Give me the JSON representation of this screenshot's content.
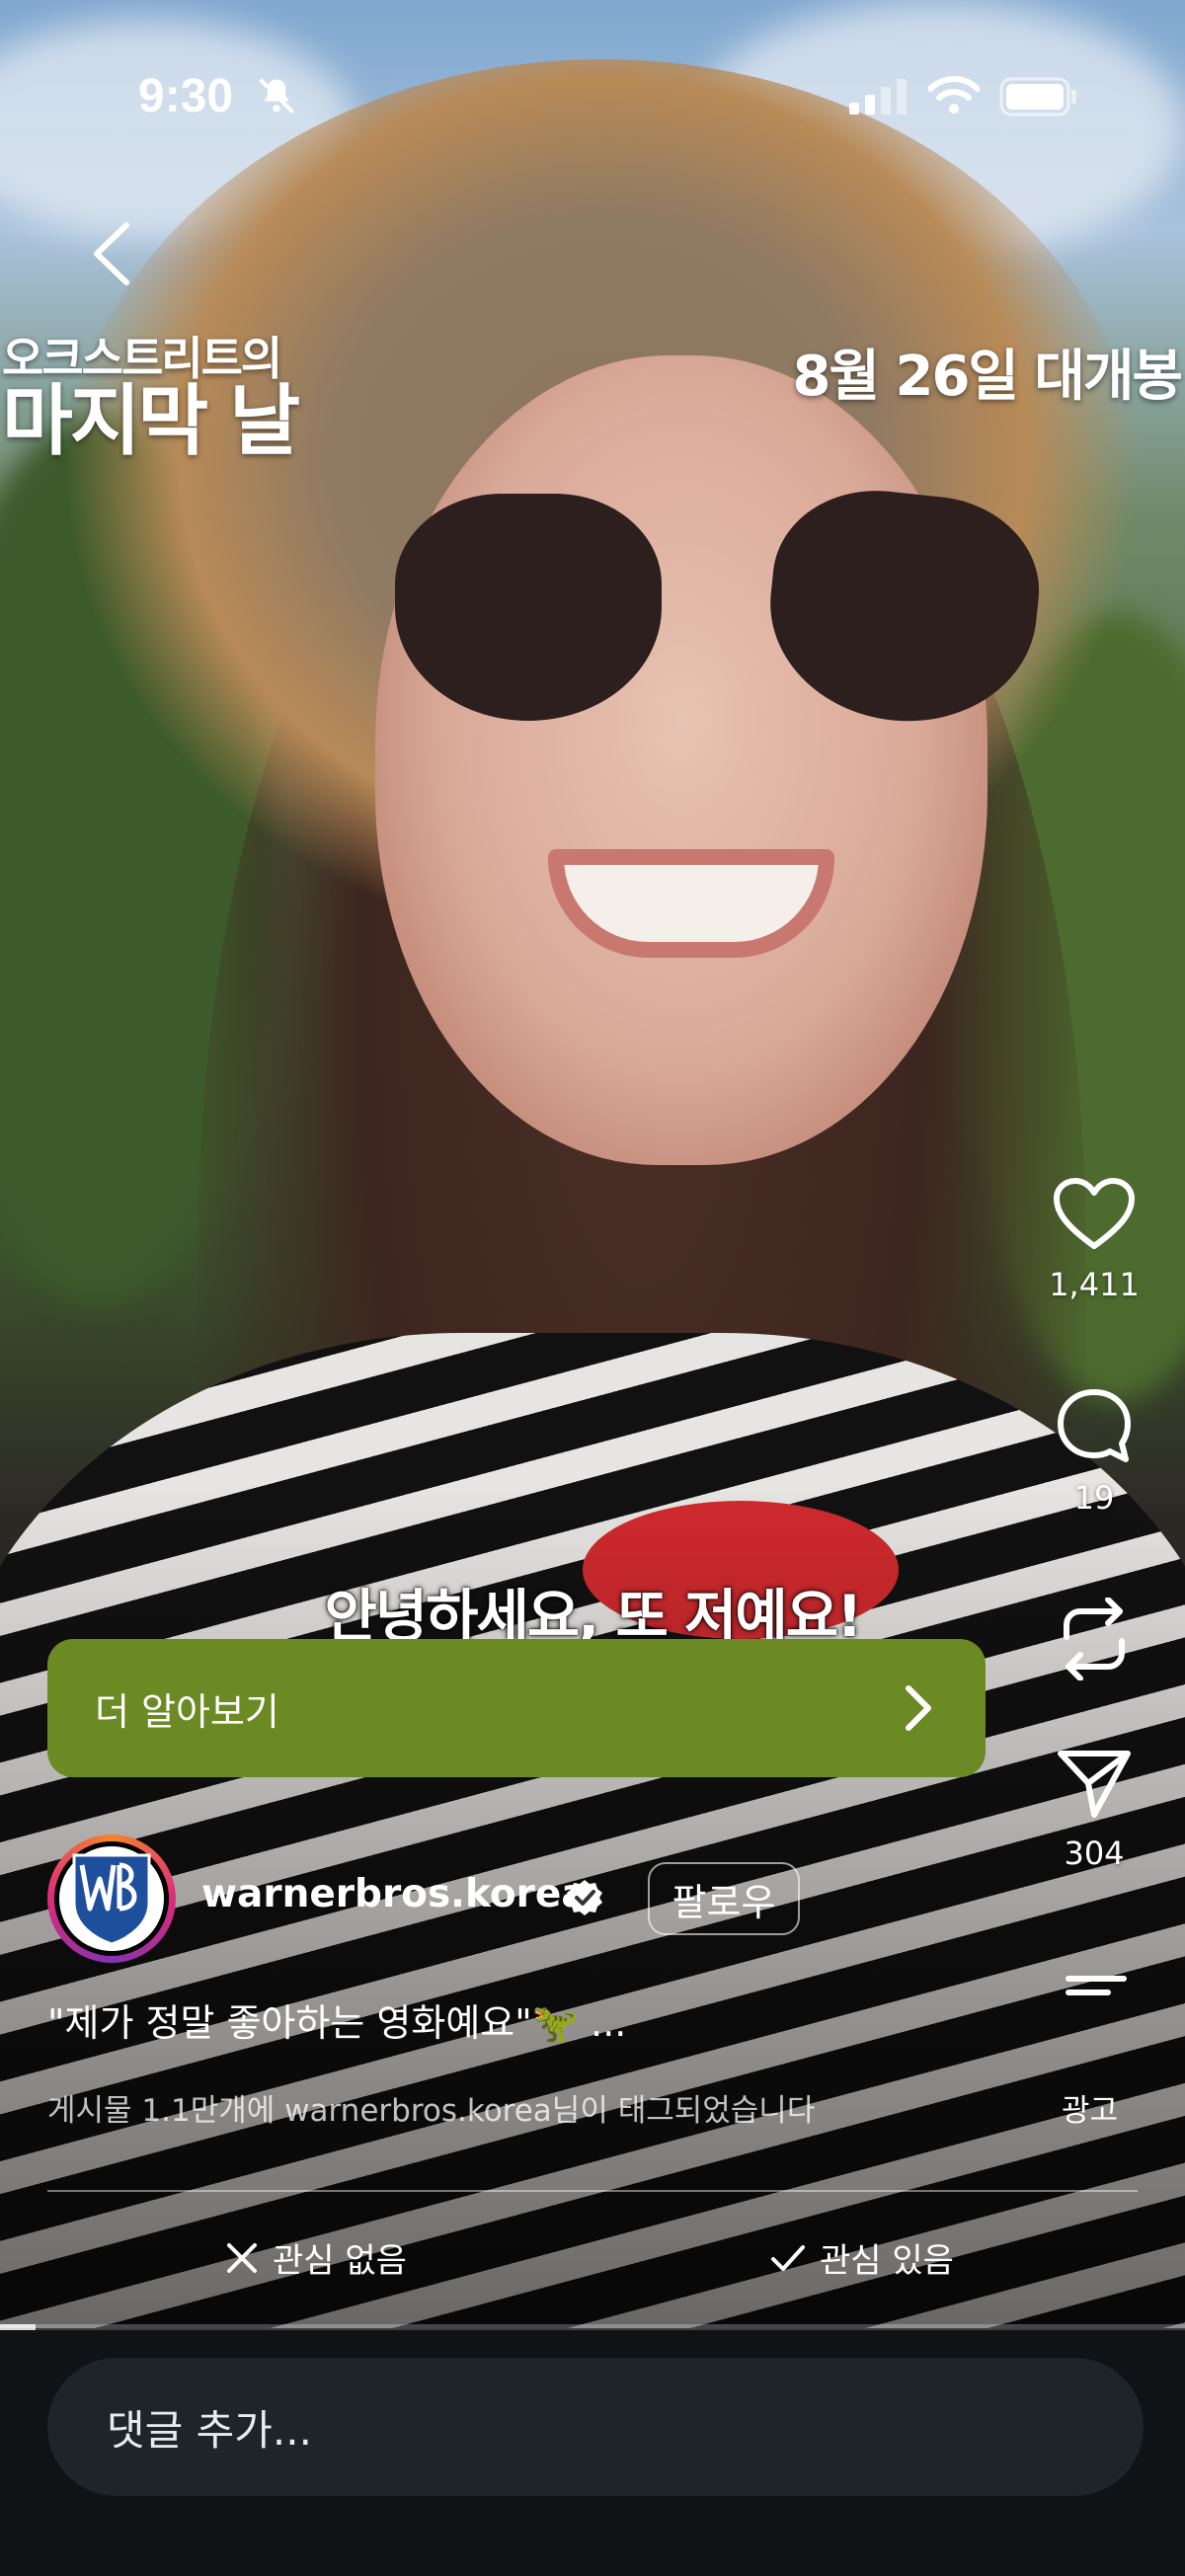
{
  "status_bar": {
    "time": "9:30"
  },
  "poster": {
    "title_line1": "오크스트리트의",
    "title_line2": "마지막 날",
    "release": "8월 26일 대개봉"
  },
  "actions": {
    "likes": "1,411",
    "comments": "19",
    "shares": "304",
    "ad_label": "광고"
  },
  "subtitle": "안녕하세요, 또 저예요!",
  "cta": {
    "label": "더 알아보기"
  },
  "account": {
    "username": "warnerbros.korea",
    "follow_label": "팔로우"
  },
  "caption": "\"제가 정말 좋아하는 영화예요\"🦖 ...",
  "tagged_text": "게시물 1.1만개에 warnerbros.korea님이 태그되었습니다",
  "feedback": {
    "not_interested": "관심 없음",
    "interested": "관심 있음"
  },
  "video_progress": 0.03,
  "comment": {
    "placeholder": "댓글 추가..."
  },
  "colors": {
    "cta": "#6b8a24",
    "bottom_bar": "#0f1316"
  }
}
